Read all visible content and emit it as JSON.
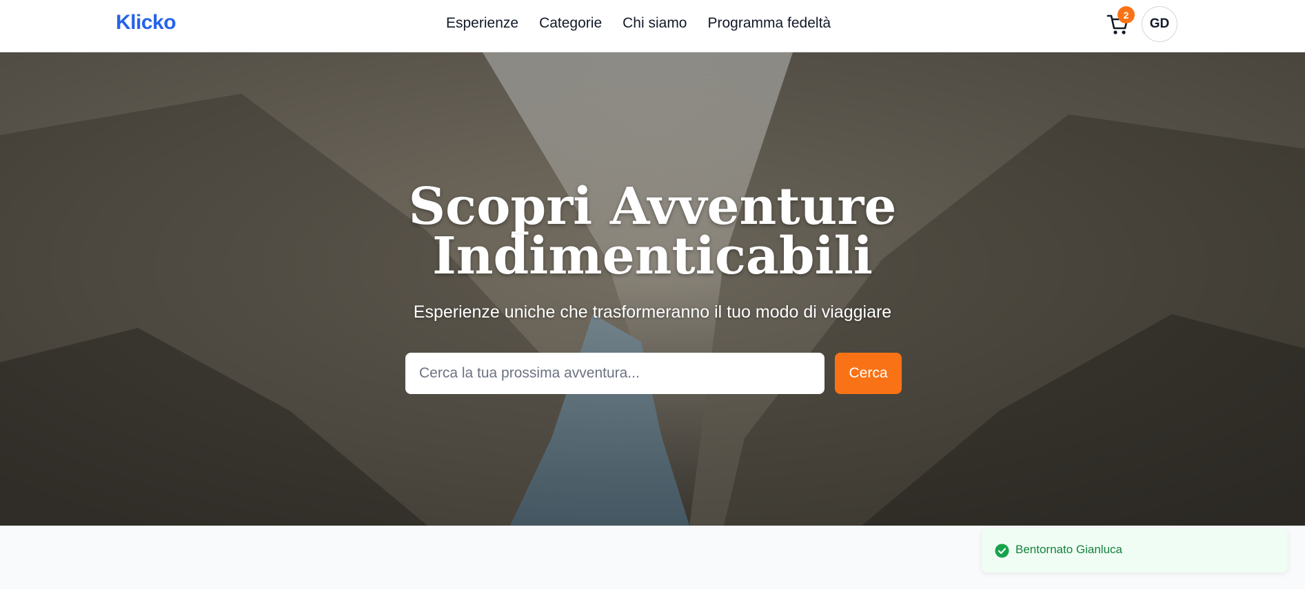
{
  "header": {
    "logo": "Klicko",
    "nav": [
      "Esperienze",
      "Categorie",
      "Chi siamo",
      "Programma fedeltà"
    ],
    "cart_count": "2",
    "avatar_initials": "GD"
  },
  "hero": {
    "title_line1": "Scopri Avventure",
    "title_line2": "Indimenticabili",
    "subtitle": "Esperienze uniche che trasformeranno il tuo modo di viaggiare",
    "search_placeholder": "Cerca la tua prossima avventura...",
    "search_button": "Cerca"
  },
  "toast": {
    "message": "Bentornato Gianluca"
  },
  "icons": {
    "cart": "cart-icon",
    "toast": "check-circle-icon"
  },
  "colors": {
    "brand": "#2563eb",
    "accent": "#f97316",
    "success": "#16a34a"
  }
}
